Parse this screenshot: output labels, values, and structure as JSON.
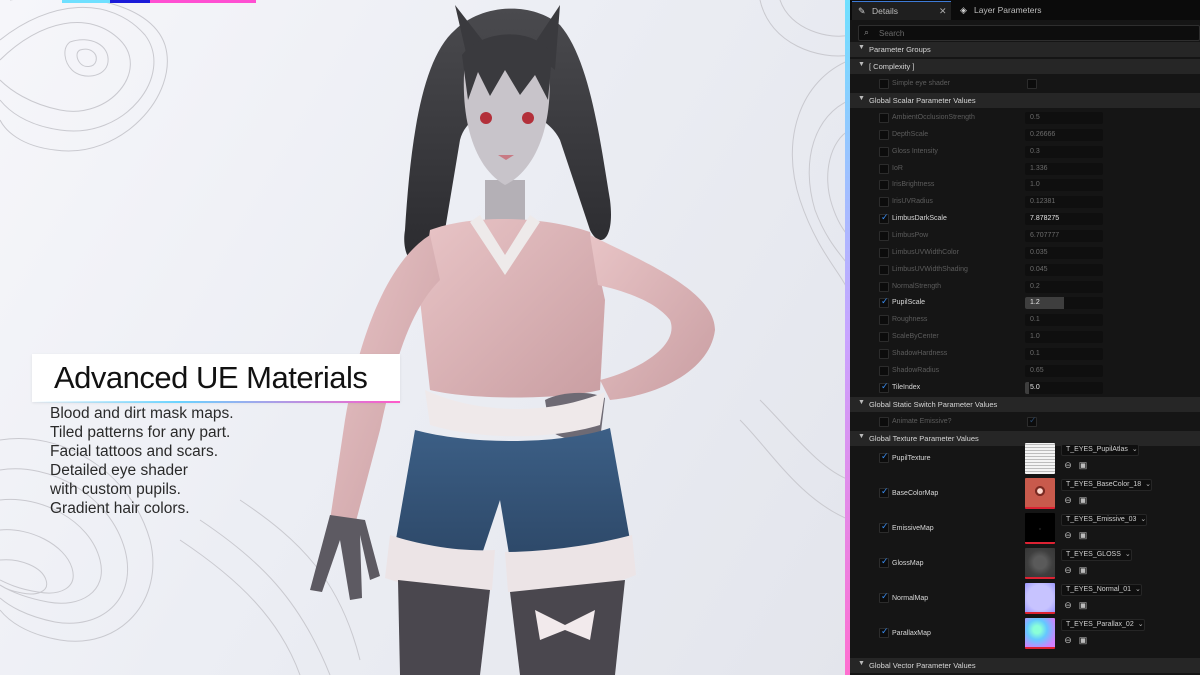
{
  "promo": {
    "title": "Advanced UE Materials",
    "features": [
      "Blood and dirt mask maps.",
      "Tiled patterns for any part.",
      "Facial tattoos and scars.",
      "Detailed eye shader",
      "with custom pupils.",
      "Gradient hair colors."
    ],
    "accent_colors": [
      "#6fe0ff",
      "#1b1bd8",
      "#ff4fd2"
    ]
  },
  "panel": {
    "tabs": {
      "details": "Details",
      "layers": "Layer Parameters"
    },
    "search_placeholder": "Search",
    "sections": {
      "parameter_groups": "Parameter Groups",
      "complexity": "[ Complexity ]",
      "scalar": "Global Scalar Parameter Values",
      "static_switch": "Global Static Switch Parameter Values",
      "texture": "Global Texture Parameter Values",
      "vector": "Global Vector Parameter Values"
    },
    "complexity": {
      "label": "Simple eye shader",
      "enabled": false,
      "value_checked": false
    },
    "scalars": [
      {
        "name": "AmbientOcclusionStrength",
        "value": "0.5",
        "enabled": false
      },
      {
        "name": "DepthScale",
        "value": "0.26666",
        "enabled": false
      },
      {
        "name": "Gloss Intensity",
        "value": "0.3",
        "enabled": false
      },
      {
        "name": "IoR",
        "value": "1.336",
        "enabled": false
      },
      {
        "name": "IrisBrightness",
        "value": "1.0",
        "enabled": false
      },
      {
        "name": "IrisUVRadius",
        "value": "0.12381",
        "enabled": false
      },
      {
        "name": "LimbusDarkScale",
        "value": "7.878275",
        "enabled": true,
        "fill": 0
      },
      {
        "name": "LimbusPow",
        "value": "6.707777",
        "enabled": false
      },
      {
        "name": "LimbusUVWidthColor",
        "value": "0.035",
        "enabled": false
      },
      {
        "name": "LimbusUVWidthShading",
        "value": "0.045",
        "enabled": false
      },
      {
        "name": "NormalStrength",
        "value": "0.2",
        "enabled": false
      },
      {
        "name": "PupilScale",
        "value": "1.2",
        "enabled": true,
        "fill": 0.5
      },
      {
        "name": "Roughness",
        "value": "0.1",
        "enabled": false
      },
      {
        "name": "ScaleByCenter",
        "value": "1.0",
        "enabled": false
      },
      {
        "name": "ShadowHardness",
        "value": "0.1",
        "enabled": false
      },
      {
        "name": "ShadowRadius",
        "value": "0.65",
        "enabled": false
      },
      {
        "name": "TileIndex",
        "value": "5.0",
        "enabled": true,
        "fill": 0.05
      }
    ],
    "static_switch": {
      "label": "Animate Emissive?",
      "enabled": false,
      "value_checked": true
    },
    "textures": [
      {
        "name": "PupilTexture",
        "asset": "T_EYES_PupilAtlas",
        "enabled": true,
        "thumb": "pupil-atlas"
      },
      {
        "name": "BaseColorMap",
        "asset": "T_EYES_BaseColor_18",
        "enabled": true,
        "thumb": "basecolor"
      },
      {
        "name": "EmissiveMap",
        "asset": "T_EYES_Emissive_03",
        "enabled": true,
        "thumb": "emissive"
      },
      {
        "name": "GlossMap",
        "asset": "T_EYES_GLOSS",
        "enabled": true,
        "thumb": "gloss"
      },
      {
        "name": "NormalMap",
        "asset": "T_EYES_Normal_01",
        "enabled": true,
        "thumb": "normal"
      },
      {
        "name": "ParallaxMap",
        "asset": "T_EYES_Parallax_02",
        "enabled": true,
        "thumb": "parallax"
      }
    ]
  }
}
